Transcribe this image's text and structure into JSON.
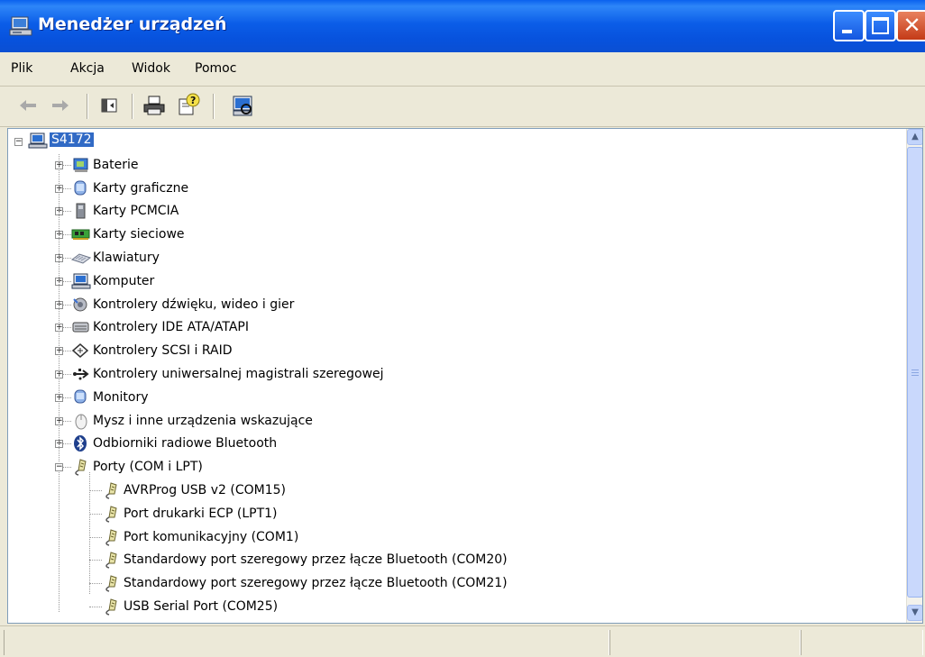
{
  "window": {
    "title": "Menedżer urządzeń",
    "controls": {
      "minimize": "minimize-icon",
      "maximize": "maximize-icon",
      "close": "close-icon"
    }
  },
  "menu": [
    {
      "label": "Plik"
    },
    {
      "label": "Akcja"
    },
    {
      "label": "Widok"
    },
    {
      "label": "Pomoc"
    }
  ],
  "toolbar": [
    {
      "icon": "back-arrow-icon"
    },
    {
      "icon": "forward-arrow-icon"
    },
    {
      "icon": "show-hide-console-tree-icon"
    },
    {
      "icon": "print-icon"
    },
    {
      "icon": "properties-help-icon"
    },
    {
      "icon": "scan-hardware-icon"
    }
  ],
  "tree": {
    "root": {
      "label": "S4172",
      "icon": "computer-icon",
      "selected": true,
      "expanded": true
    },
    "categories": [
      {
        "label": "Baterie",
        "icon": "battery-icon"
      },
      {
        "label": "Karty graficzne",
        "icon": "display-adapter-icon"
      },
      {
        "label": "Karty PCMCIA",
        "icon": "pcmcia-card-icon"
      },
      {
        "label": "Karty sieciowe",
        "icon": "network-card-icon"
      },
      {
        "label": "Klawiatury",
        "icon": "keyboard-icon"
      },
      {
        "label": "Komputer",
        "icon": "computer-icon"
      },
      {
        "label": "Kontrolery dźwięku, wideo i gier",
        "icon": "sound-icon"
      },
      {
        "label": "Kontrolery IDE ATA/ATAPI",
        "icon": "ide-controller-icon"
      },
      {
        "label": "Kontrolery SCSI i RAID",
        "icon": "scsi-icon"
      },
      {
        "label": "Kontrolery uniwersalnej magistrali szeregowej",
        "icon": "usb-icon"
      },
      {
        "label": "Monitory",
        "icon": "monitor-icon"
      },
      {
        "label": "Mysz i inne urządzenia wskazujące",
        "icon": "mouse-icon"
      },
      {
        "label": "Odbiorniki radiowe Bluetooth",
        "icon": "bluetooth-icon"
      },
      {
        "label": "Porty (COM i LPT)",
        "icon": "port-icon",
        "expanded": true
      }
    ],
    "port_children": [
      {
        "label": "AVRProg USB v2 (COM15)",
        "icon": "port-icon"
      },
      {
        "label": "Port drukarki ECP (LPT1)",
        "icon": "port-icon"
      },
      {
        "label": "Port komunikacyjny (COM1)",
        "icon": "port-icon"
      },
      {
        "label": "Standardowy port szeregowy przez łącze Bluetooth (COM20)",
        "icon": "port-icon"
      },
      {
        "label": "Standardowy port szeregowy przez łącze Bluetooth (COM21)",
        "icon": "port-icon"
      },
      {
        "label": "USB Serial Port (COM25)",
        "icon": "port-icon"
      }
    ]
  },
  "scrollbar": {
    "position": 0.0
  },
  "statusbar": {
    "cells": [
      "",
      "",
      ""
    ]
  },
  "colors": {
    "titlebar": "#0b5de8",
    "selection": "#316ac5",
    "face": "#ece9d8"
  }
}
